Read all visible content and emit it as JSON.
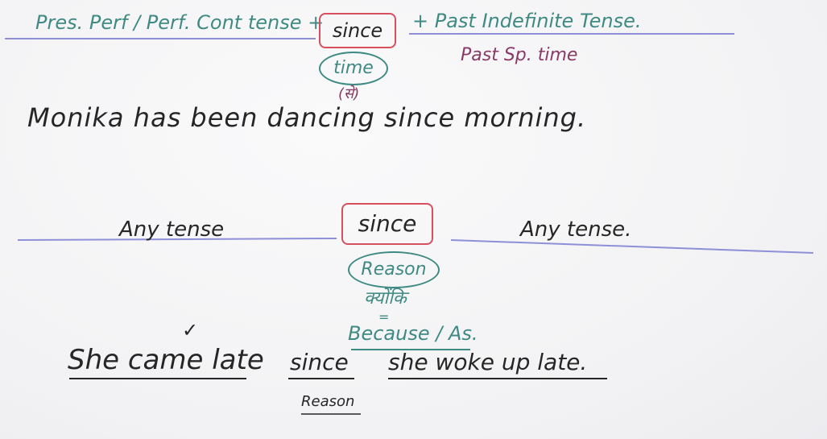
{
  "rule1": {
    "left": "Pres. Perf / Perf. Cont tense +",
    "connector": "since",
    "right": "+ Past Indefinite Tense.",
    "tag": "time",
    "hindi": "(से)",
    "right_note": "Past Sp. time"
  },
  "example1": "Monika has been dancing since morning.",
  "rule2": {
    "left": "Any tense",
    "connector": "since",
    "right": "Any tense.",
    "tag": "Reason",
    "hindi": "क्योंकि",
    "equals": "=",
    "meaning": "Because / As."
  },
  "example2": {
    "clause1": "She came late",
    "connector": "since",
    "clause2": "she woke up late.",
    "tick": "✓",
    "note": "Reason"
  },
  "colors": {
    "teal": "#3f8a83",
    "purple": "#8a3a66",
    "ink": "#262626",
    "red": "#d24a5a",
    "line": "#8f8fd8"
  }
}
